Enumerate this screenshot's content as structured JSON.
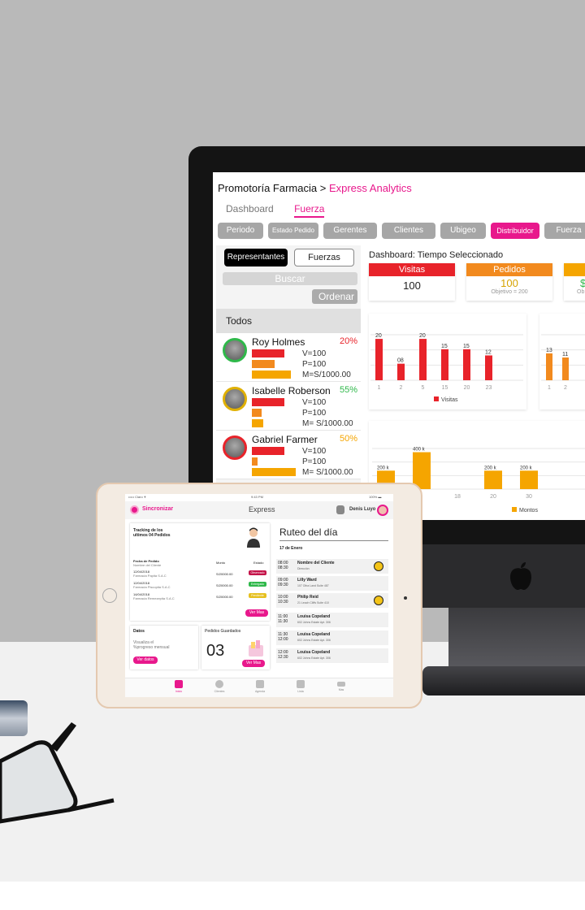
{
  "desktop": {
    "app_title": "Promotoría Farmacia",
    "breadcrumb_sep": ">",
    "app_sub": "Express Analytics",
    "tabs": [
      "Dashboard",
      "Fuerza"
    ],
    "filters": [
      "Periodo",
      "Estado Pedido",
      "Gerentes",
      "Clientes",
      "Ubigeo",
      "Distribuidor",
      "Fuerza"
    ],
    "selected_filter": "Distribuidor",
    "rep_button": "Representantes",
    "fuerzas_button": "Fuerzas",
    "search_placeholder": "Buscar",
    "order_button": "Ordenar",
    "list_header": "Todos",
    "reps": [
      {
        "name": "Roy Holmes",
        "pct": "20%",
        "pct_color": "#e8232a",
        "v": "V=100",
        "p": "P=100",
        "m": "M=S/1000.00",
        "bars": [
          0.45,
          0.32,
          0.8
        ]
      },
      {
        "name": "Isabelle Roberson",
        "pct": "55%",
        "pct_color": "#2fb84a",
        "v": "V=100",
        "p": "P=100",
        "m": "M= S/1000.00",
        "bars": [
          0.45,
          0.14,
          0.18
        ]
      },
      {
        "name": "Gabriel Farmer",
        "pct": "50%",
        "pct_color": "#f5a500",
        "v": "V=100",
        "p": "P=100",
        "m": "M= S/1000.00",
        "bars": [
          0.45,
          0.08,
          0.8
        ]
      }
    ],
    "dashboard_title": "Dashboard: Tiempo Seleccionado",
    "kpis": [
      {
        "label": "Visitas",
        "value": "100",
        "sub": "",
        "color": "#e8232a",
        "value_color": "#111"
      },
      {
        "label": "Pedidos",
        "value": "100",
        "sub": "Objetivo = 200",
        "color": "#f28a1e",
        "value_color": "#d6a300"
      },
      {
        "label": "",
        "value": "$",
        "sub": "Ob",
        "color": "#f5a500",
        "value_color": "#2fb84a"
      }
    ]
  },
  "chart_data": [
    {
      "type": "bar",
      "categories": [
        "1",
        "2",
        "5",
        "15",
        "20",
        "23"
      ],
      "series": [
        {
          "name": "Visitas",
          "values": [
            20,
            8,
            20,
            15,
            15,
            12
          ]
        }
      ],
      "data_labels": [
        "20",
        "08",
        "20",
        "15",
        "15",
        "12"
      ],
      "ylim": [
        0,
        22
      ],
      "color": "#e8232a",
      "legend_position": "bottom"
    },
    {
      "type": "bar",
      "categories": [
        "1",
        "2"
      ],
      "values": [
        13,
        11
      ],
      "data_labels": [
        "13",
        "11"
      ],
      "ylim": [
        0,
        22
      ],
      "color": "#f28a1e"
    },
    {
      "type": "bar",
      "categories": [
        "",
        "",
        "18",
        "20",
        "30"
      ],
      "series": [
        {
          "name": "Montos",
          "values": [
            200,
            400,
            0,
            200,
            200
          ]
        }
      ],
      "data_labels": [
        "200 k",
        "400 k",
        "",
        "200 k",
        "200 k"
      ],
      "ylim": [
        0,
        440
      ],
      "color": "#f5a500",
      "legend_position": "bottom"
    }
  ],
  "ipad": {
    "status_left": "••••• Claro ✈",
    "status_time": "9:43 PM",
    "status_right": "100% ▬",
    "sync_label": "Sincronizar",
    "header_title": "Express",
    "user_name": "Denis Luyo",
    "tracking_title_1": "Tracking de los",
    "tracking_title_2": "ultimos 04 Pedidos",
    "orders_headers": [
      "Fecha de Pedido",
      "Monto",
      "Estado"
    ],
    "orders_sub_header": "Nombre del Cliente",
    "orders": [
      {
        "date": "12/04/2018",
        "client": "Farmacia Papita S.A.C",
        "amount": "S/20000.00",
        "status": "Observado",
        "color": "#c4144a"
      },
      {
        "date": "12/04/2018",
        "client": "Farmacia Piscopita S.A.C",
        "amount": "S/20000.00",
        "status": "Entregado",
        "color": "#2fb84a"
      },
      {
        "date": "14/04/2018",
        "client": "Farmacia Remezepita S.A.C",
        "amount": "S/20000.00",
        "status": "Pendiente",
        "color": "#e6c020"
      }
    ],
    "ver_mas": "Ver Mas",
    "datos_title": "Datos",
    "datos_desc_1": "Visualiza el",
    "datos_desc_2": "%progreso mensual",
    "ver_datos": "Ver datos",
    "pedidos_title": "Pedidos Guardados",
    "pedidos_count": "03",
    "ruteo_title": "Ruteo del día",
    "ruteo_date": "17 de Enero",
    "routes": [
      {
        "t1": "08:00",
        "t2": "08:30",
        "name": "Nombre del Cliente",
        "addr": "Dirección",
        "check": true
      },
      {
        "t1": "09:00",
        "t2": "09:30",
        "name": "Lilly Ward",
        "addr": "107 Olha Land Suite 487",
        "check": false
      },
      {
        "t1": "10:00",
        "t2": "10:30",
        "name": "Philip Reid",
        "addr": "21 Leach Cliffs Suite 410",
        "check": true
      },
      {
        "t1": "11:00",
        "t2": "11:30",
        "name": "Louisa Copeland",
        "addr": "602 Johns Estate Apt. 306",
        "check": false
      },
      {
        "t1": "11:30",
        "t2": "12:00",
        "name": "Louisa Copeland",
        "addr": "602 Johns Estate Apt. 306",
        "check": false
      },
      {
        "t1": "12:00",
        "t2": "12:30",
        "name": "Louisa Copeland",
        "addr": "602 Johns Estate Apt. 306",
        "check": false
      }
    ],
    "nav": [
      "Inicio",
      "Clientes",
      "Agenda",
      "Lista",
      "Mas"
    ]
  }
}
